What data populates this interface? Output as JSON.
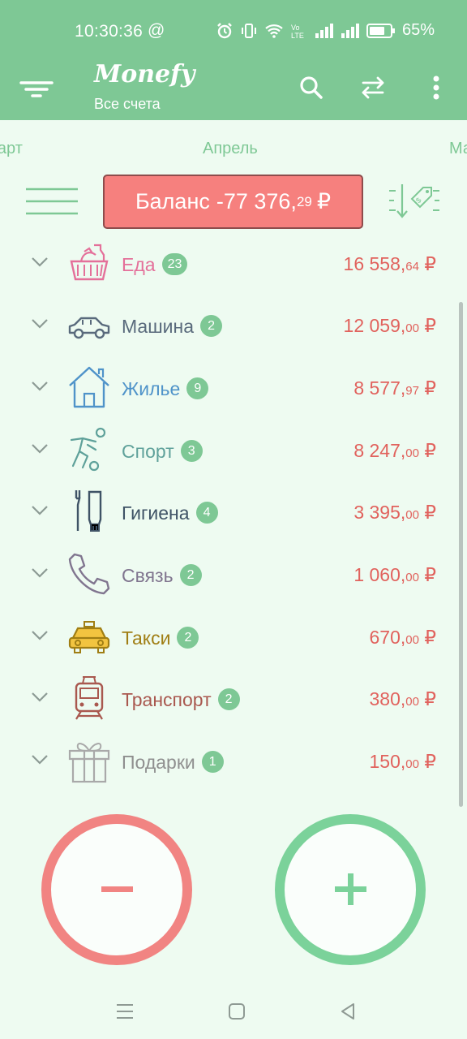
{
  "status_bar": {
    "time": "10:30:36",
    "at_symbol": "@",
    "battery": "65%",
    "icons": [
      "alarm-icon",
      "vibrate-icon",
      "wifi-icon",
      "volte-icon",
      "signal-icon",
      "signal-icon",
      "battery-icon"
    ]
  },
  "app_bar": {
    "title": "Monefy",
    "subtitle": "Все счета",
    "icons": [
      "filter-menu-icon",
      "search-icon",
      "transfer-icon",
      "more-vert-icon"
    ]
  },
  "months": {
    "prev": "Март",
    "current": "Апрель",
    "next": "Май"
  },
  "balance": {
    "prefix": "Баланс",
    "amount_main": "-77 376,",
    "amount_cents": "29",
    "currency": "₽"
  },
  "categories": [
    {
      "name": "Еда",
      "count": "23",
      "main": "16 558,",
      "cents": "64",
      "currency": "₽",
      "icon": "food-basket-icon",
      "color": "#e4709a"
    },
    {
      "name": "Машина",
      "count": "2",
      "main": "12 059,",
      "cents": "00",
      "currency": "₽",
      "icon": "car-icon",
      "color": "#596a7c"
    },
    {
      "name": "Жилье",
      "count": "9",
      "main": "8 577,",
      "cents": "97",
      "currency": "₽",
      "icon": "house-icon",
      "color": "#4f93c9"
    },
    {
      "name": "Спорт",
      "count": "3",
      "main": "8 247,",
      "cents": "00",
      "currency": "₽",
      "icon": "soccer-player-icon",
      "color": "#5fa19a"
    },
    {
      "name": "Гигиена",
      "count": "4",
      "main": "3 395,",
      "cents": "00",
      "currency": "₽",
      "icon": "toothbrush-toothpaste-icon",
      "color": "#3f5366"
    },
    {
      "name": "Связь",
      "count": "2",
      "main": "1 060,",
      "cents": "00",
      "currency": "₽",
      "icon": "phone-icon",
      "color": "#80758f"
    },
    {
      "name": "Такси",
      "count": "2",
      "main": "670,",
      "cents": "00",
      "currency": "₽",
      "icon": "taxi-icon",
      "color": "#a07e14"
    },
    {
      "name": "Транспорт",
      "count": "2",
      "main": "380,",
      "cents": "00",
      "currency": "₽",
      "icon": "train-icon",
      "color": "#a9584f"
    },
    {
      "name": "Подарки",
      "count": "1",
      "main": "150,",
      "cents": "00",
      "currency": "₽",
      "icon": "gift-icon",
      "color": "#8f8f8f"
    }
  ],
  "buttons": {
    "expense": "−",
    "income": "+"
  },
  "colors": {
    "accent_green": "#7ec895",
    "expense_red": "#f18482",
    "amount_red": "#e1625d",
    "background": "#eefbf1"
  }
}
